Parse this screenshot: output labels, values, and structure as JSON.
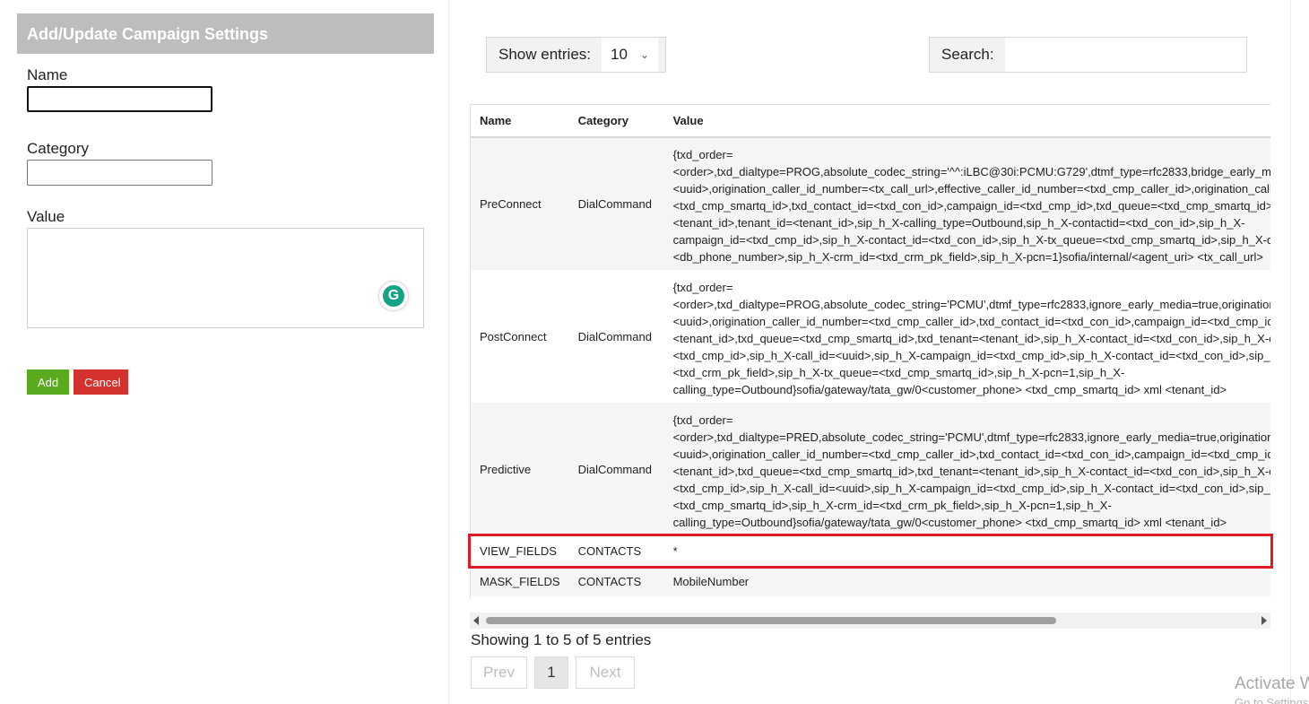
{
  "form": {
    "title": "Add/Update Campaign Settings",
    "name_label": "Name",
    "name_value": "",
    "category_label": "Category",
    "category_value": "",
    "value_label": "Value",
    "value_value": "",
    "add_label": "Add",
    "cancel_label": "Cancel",
    "grammarly_letter": "G"
  },
  "table_controls": {
    "show_entries_label": "Show entries:",
    "show_entries_value": "10",
    "search_label": "Search:",
    "search_value": ""
  },
  "table": {
    "headers": [
      "Name",
      "Category",
      "Value"
    ],
    "rows": [
      {
        "name": "PreConnect",
        "category": "DialCommand",
        "value_lines": [
          "{txd_order=",
          "<order>,txd_dialtype=PROG,absolute_codec_string='^^:iLBC@30i:PCMU:G729',dtmf_type=rfc2833,bridge_early_media=true,origination_uuid=",
          "<uuid>,origination_caller_id_number=<tx_call_url>,effective_caller_id_number=<txd_cmp_caller_id>,origination_caller_id_name=",
          "<txd_cmp_smartq_id>,txd_contact_id=<txd_con_id>,campaign_id=<txd_cmp_id>,txd_queue=<txd_cmp_smartq_id>,txd_tenant=",
          "<tenant_id>,tenant_id=<tenant_id>,sip_h_X-calling_type=Outbound,sip_h_X-contactid=<txd_con_id>,sip_h_X-",
          "campaign_id=<txd_cmp_id>,sip_h_X-contact_id=<txd_con_id>,sip_h_X-tx_queue=<txd_cmp_smartq_id>,sip_h_X-db_phone=",
          "<db_phone_number>,sip_h_X-crm_id=<txd_crm_pk_field>,sip_h_X-pcn=1}sofia/internal/<agent_uri> <tx_call_url>"
        ]
      },
      {
        "name": "PostConnect",
        "category": "DialCommand",
        "value_lines": [
          "{txd_order=",
          "<order>,txd_dialtype=PROG,absolute_codec_string='PCMU',dtmf_type=rfc2833,ignore_early_media=true,origination_uuid=",
          "<uuid>,origination_caller_id_number=<txd_cmp_caller_id>,txd_contact_id=<txd_con_id>,campaign_id=<txd_cmp_id>,txd_tenant=",
          "<tenant_id>,txd_queue=<txd_cmp_smartq_id>,txd_tenant=<tenant_id>,sip_h_X-contact_id=<txd_con_id>,sip_h_X-campaign_id=",
          "<txd_cmp_id>,sip_h_X-call_id=<uuid>,sip_h_X-campaign_id=<txd_cmp_id>,sip_h_X-contact_id=<txd_con_id>,sip_h_X-crm_id=",
          "<txd_crm_pk_field>,sip_h_X-tx_queue=<txd_cmp_smartq_id>,sip_h_X-pcn=1,sip_h_X-",
          "calling_type=Outbound}sofia/gateway/tata_gw/0<customer_phone> <txd_cmp_smartq_id> xml <tenant_id>"
        ]
      },
      {
        "name": "Predictive",
        "category": "DialCommand",
        "value_lines": [
          "{txd_order=",
          "<order>,txd_dialtype=PRED,absolute_codec_string='PCMU',dtmf_type=rfc2833,ignore_early_media=true,origination_uuid=",
          "<uuid>,origination_caller_id_number=<txd_cmp_caller_id>,txd_contact_id=<txd_con_id>,campaign_id=<txd_cmp_id>,txd_tenant=",
          "<tenant_id>,txd_queue=<txd_cmp_smartq_id>,txd_tenant=<tenant_id>,sip_h_X-contact_id=<txd_con_id>,sip_h_X-campaign_id=",
          "<txd_cmp_id>,sip_h_X-call_id=<uuid>,sip_h_X-campaign_id=<txd_cmp_id>,sip_h_X-contact_id=<txd_con_id>,sip_h_X-crm_id=",
          "<txd_cmp_smartq_id>,sip_h_X-crm_id=<txd_crm_pk_field>,sip_h_X-pcn=1,sip_h_X-",
          "calling_type=Outbound}sofia/gateway/tata_gw/0<customer_phone> <txd_cmp_smartq_id> xml <tenant_id>"
        ]
      },
      {
        "name": "VIEW_FIELDS",
        "category": "CONTACTS",
        "value_lines": [
          "*"
        ]
      },
      {
        "name": "MASK_FIELDS",
        "category": "CONTACTS",
        "value_lines": [
          "MobileNumber"
        ]
      }
    ],
    "highlighted_row": "VIEW_FIELDS",
    "highlight_color": "#e01b24"
  },
  "pagination": {
    "info": "Showing 1 to 5 of 5 entries",
    "prev_label": "Prev",
    "current_page": "1",
    "next_label": "Next"
  },
  "watermark": {
    "line1": "Activate Windows",
    "line2": "Go to Settings to activate Windows."
  },
  "colors": {
    "header_bg": "#bdbdbd",
    "add_button": "#5aaa1f",
    "cancel_button": "#d3322f"
  }
}
